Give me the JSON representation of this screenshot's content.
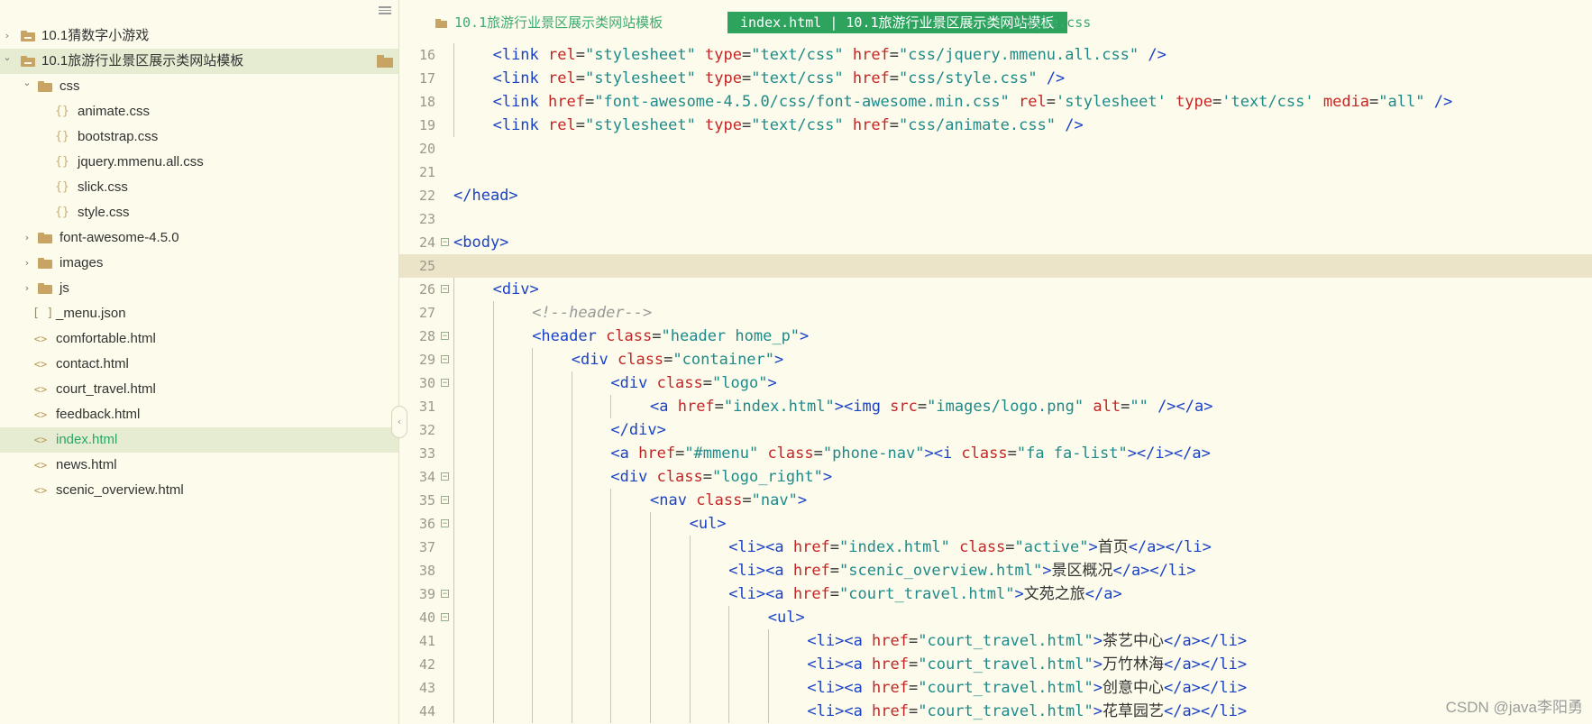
{
  "sidebar": {
    "items": [
      {
        "level": 0,
        "kind": "project",
        "expanded": false,
        "label": "10.1猜数字小游戏"
      },
      {
        "level": 0,
        "kind": "project",
        "expanded": true,
        "label": "10.1旅游行业景区展示类网站模板",
        "selected": true
      },
      {
        "level": 1,
        "kind": "folder",
        "expanded": true,
        "label": "css"
      },
      {
        "level": 2,
        "kind": "css",
        "label": "animate.css"
      },
      {
        "level": 2,
        "kind": "css",
        "label": "bootstrap.css"
      },
      {
        "level": 2,
        "kind": "css",
        "label": "jquery.mmenu.all.css"
      },
      {
        "level": 2,
        "kind": "css",
        "label": "slick.css"
      },
      {
        "level": 2,
        "kind": "css",
        "label": "style.css"
      },
      {
        "level": 1,
        "kind": "folder",
        "expanded": false,
        "label": "font-awesome-4.5.0"
      },
      {
        "level": 1,
        "kind": "folder",
        "expanded": false,
        "label": "images"
      },
      {
        "level": 1,
        "kind": "folder",
        "expanded": false,
        "label": "js"
      },
      {
        "level": 1,
        "kind": "json",
        "label": "_menu.json"
      },
      {
        "level": 1,
        "kind": "html",
        "label": "comfortable.html"
      },
      {
        "level": 1,
        "kind": "html",
        "label": "contact.html"
      },
      {
        "level": 1,
        "kind": "html",
        "label": "court_travel.html"
      },
      {
        "level": 1,
        "kind": "html",
        "label": "feedback.html"
      },
      {
        "level": 1,
        "kind": "html",
        "label": "index.html",
        "active": true
      },
      {
        "level": 1,
        "kind": "html",
        "label": "news.html"
      },
      {
        "level": 1,
        "kind": "html",
        "label": "scenic_overview.html"
      }
    ]
  },
  "tabs": [
    {
      "label": "10.1旅游行业景区展示类网站模板",
      "kind": "project",
      "active": false
    },
    {
      "label": "index.html | 10.1旅游行业景区展示类网站模板",
      "kind": "file",
      "active": true
    },
    {
      "label": "style.css",
      "kind": "file",
      "active": false
    }
  ],
  "code": {
    "current_line": 25,
    "lines": [
      {
        "n": 16,
        "indent": 1,
        "tokens": [
          [
            "t",
            "<link "
          ],
          [
            "a",
            "rel"
          ],
          [
            "x",
            "="
          ],
          [
            "v",
            "\"stylesheet\" "
          ],
          [
            "a",
            "type"
          ],
          [
            "x",
            "="
          ],
          [
            "v",
            "\"text/css\" "
          ],
          [
            "a",
            "href"
          ],
          [
            "x",
            "="
          ],
          [
            "v",
            "\"css/jquery.mmenu.all.css\" "
          ],
          [
            "t",
            "/>"
          ]
        ]
      },
      {
        "n": 17,
        "indent": 1,
        "tokens": [
          [
            "t",
            "<link "
          ],
          [
            "a",
            "rel"
          ],
          [
            "x",
            "="
          ],
          [
            "v",
            "\"stylesheet\" "
          ],
          [
            "a",
            "type"
          ],
          [
            "x",
            "="
          ],
          [
            "v",
            "\"text/css\" "
          ],
          [
            "a",
            "href"
          ],
          [
            "x",
            "="
          ],
          [
            "v",
            "\"css/style.css\" "
          ],
          [
            "t",
            "/>"
          ]
        ]
      },
      {
        "n": 18,
        "indent": 1,
        "tokens": [
          [
            "t",
            "<link "
          ],
          [
            "a",
            "href"
          ],
          [
            "x",
            "="
          ],
          [
            "v",
            "\"font-awesome-4.5.0/css/font-awesome.min.css\" "
          ],
          [
            "a",
            "rel"
          ],
          [
            "x",
            "="
          ],
          [
            "v",
            "'stylesheet' "
          ],
          [
            "a",
            "type"
          ],
          [
            "x",
            "="
          ],
          [
            "v",
            "'text/css' "
          ],
          [
            "a",
            "media"
          ],
          [
            "x",
            "="
          ],
          [
            "v",
            "\"all\" "
          ],
          [
            "t",
            "/>"
          ]
        ]
      },
      {
        "n": 19,
        "indent": 1,
        "tokens": [
          [
            "t",
            "<link "
          ],
          [
            "a",
            "rel"
          ],
          [
            "x",
            "="
          ],
          [
            "v",
            "\"stylesheet\" "
          ],
          [
            "a",
            "type"
          ],
          [
            "x",
            "="
          ],
          [
            "v",
            "\"text/css\" "
          ],
          [
            "a",
            "href"
          ],
          [
            "x",
            "="
          ],
          [
            "v",
            "\"css/animate.css\" "
          ],
          [
            "t",
            "/>"
          ]
        ]
      },
      {
        "n": 20,
        "indent": 0,
        "tokens": []
      },
      {
        "n": 21,
        "indent": 0,
        "tokens": []
      },
      {
        "n": 22,
        "indent": 0,
        "tokens": [
          [
            "t",
            "</head>"
          ]
        ]
      },
      {
        "n": 23,
        "indent": 0,
        "tokens": []
      },
      {
        "n": 24,
        "indent": 0,
        "fold": true,
        "tokens": [
          [
            "t",
            "<body>"
          ]
        ]
      },
      {
        "n": 25,
        "indent": 0,
        "tokens": []
      },
      {
        "n": 26,
        "indent": 1,
        "fold": true,
        "tokens": [
          [
            "t",
            "<div>"
          ]
        ]
      },
      {
        "n": 27,
        "indent": 2,
        "tokens": [
          [
            "c",
            "<!--header-->"
          ]
        ]
      },
      {
        "n": 28,
        "indent": 2,
        "fold": true,
        "tokens": [
          [
            "t",
            "<header "
          ],
          [
            "a",
            "class"
          ],
          [
            "x",
            "="
          ],
          [
            "v",
            "\"header home_p\""
          ],
          [
            "t",
            ">"
          ]
        ]
      },
      {
        "n": 29,
        "indent": 3,
        "fold": true,
        "tokens": [
          [
            "t",
            "<div "
          ],
          [
            "a",
            "class"
          ],
          [
            "x",
            "="
          ],
          [
            "v",
            "\"container\""
          ],
          [
            "t",
            ">"
          ]
        ]
      },
      {
        "n": 30,
        "indent": 4,
        "fold": true,
        "tokens": [
          [
            "t",
            "<div "
          ],
          [
            "a",
            "class"
          ],
          [
            "x",
            "="
          ],
          [
            "v",
            "\"logo\""
          ],
          [
            "t",
            ">"
          ]
        ]
      },
      {
        "n": 31,
        "indent": 5,
        "tokens": [
          [
            "t",
            "<a "
          ],
          [
            "a",
            "href"
          ],
          [
            "x",
            "="
          ],
          [
            "v",
            "\"index.html\""
          ],
          [
            "t",
            "><img "
          ],
          [
            "a",
            "src"
          ],
          [
            "x",
            "="
          ],
          [
            "v",
            "\"images/logo.png\" "
          ],
          [
            "a",
            "alt"
          ],
          [
            "x",
            "="
          ],
          [
            "v",
            "\"\" "
          ],
          [
            "t",
            "/></a>"
          ]
        ]
      },
      {
        "n": 32,
        "indent": 4,
        "tokens": [
          [
            "t",
            "</div>"
          ]
        ]
      },
      {
        "n": 33,
        "indent": 4,
        "tokens": [
          [
            "t",
            "<a "
          ],
          [
            "a",
            "href"
          ],
          [
            "x",
            "="
          ],
          [
            "v",
            "\"#mmenu\" "
          ],
          [
            "a",
            "class"
          ],
          [
            "x",
            "="
          ],
          [
            "v",
            "\"phone-nav\""
          ],
          [
            "t",
            "><i "
          ],
          [
            "a",
            "class"
          ],
          [
            "x",
            "="
          ],
          [
            "v",
            "\"fa fa-list\""
          ],
          [
            "t",
            "></i></a>"
          ]
        ]
      },
      {
        "n": 34,
        "indent": 4,
        "fold": true,
        "tokens": [
          [
            "t",
            "<div "
          ],
          [
            "a",
            "class"
          ],
          [
            "x",
            "="
          ],
          [
            "v",
            "\"logo_right\""
          ],
          [
            "t",
            ">"
          ]
        ]
      },
      {
        "n": 35,
        "indent": 5,
        "fold": true,
        "tokens": [
          [
            "t",
            "<nav "
          ],
          [
            "a",
            "class"
          ],
          [
            "x",
            "="
          ],
          [
            "v",
            "\"nav\""
          ],
          [
            "t",
            ">"
          ]
        ]
      },
      {
        "n": 36,
        "indent": 6,
        "fold": true,
        "tokens": [
          [
            "t",
            "<ul>"
          ]
        ]
      },
      {
        "n": 37,
        "indent": 7,
        "tokens": [
          [
            "t",
            "<li><a "
          ],
          [
            "a",
            "href"
          ],
          [
            "x",
            "="
          ],
          [
            "v",
            "\"index.html\" "
          ],
          [
            "a",
            "class"
          ],
          [
            "x",
            "="
          ],
          [
            "v",
            "\"active\""
          ],
          [
            "t",
            ">"
          ],
          [
            "x",
            "首页"
          ],
          [
            "t",
            "</a></li>"
          ]
        ]
      },
      {
        "n": 38,
        "indent": 7,
        "tokens": [
          [
            "t",
            "<li><a "
          ],
          [
            "a",
            "href"
          ],
          [
            "x",
            "="
          ],
          [
            "v",
            "\"scenic_overview.html\""
          ],
          [
            "t",
            ">"
          ],
          [
            "x",
            "景区概况"
          ],
          [
            "t",
            "</a></li>"
          ]
        ]
      },
      {
        "n": 39,
        "indent": 7,
        "fold": true,
        "tokens": [
          [
            "t",
            "<li><a "
          ],
          [
            "a",
            "href"
          ],
          [
            "x",
            "="
          ],
          [
            "v",
            "\"court_travel.html\""
          ],
          [
            "t",
            ">"
          ],
          [
            "x",
            "文苑之旅"
          ],
          [
            "t",
            "</a>"
          ]
        ]
      },
      {
        "n": 40,
        "indent": 8,
        "fold": true,
        "tokens": [
          [
            "t",
            "<ul>"
          ]
        ]
      },
      {
        "n": 41,
        "indent": 9,
        "tokens": [
          [
            "t",
            "<li><a "
          ],
          [
            "a",
            "href"
          ],
          [
            "x",
            "="
          ],
          [
            "v",
            "\"court_travel.html\""
          ],
          [
            "t",
            ">"
          ],
          [
            "x",
            "茶艺中心"
          ],
          [
            "t",
            "</a></li>"
          ]
        ]
      },
      {
        "n": 42,
        "indent": 9,
        "tokens": [
          [
            "t",
            "<li><a "
          ],
          [
            "a",
            "href"
          ],
          [
            "x",
            "="
          ],
          [
            "v",
            "\"court_travel.html\""
          ],
          [
            "t",
            ">"
          ],
          [
            "x",
            "万竹林海"
          ],
          [
            "t",
            "</a></li>"
          ]
        ]
      },
      {
        "n": 43,
        "indent": 9,
        "tokens": [
          [
            "t",
            "<li><a "
          ],
          [
            "a",
            "href"
          ],
          [
            "x",
            "="
          ],
          [
            "v",
            "\"court_travel.html\""
          ],
          [
            "t",
            ">"
          ],
          [
            "x",
            "创意中心"
          ],
          [
            "t",
            "</a></li>"
          ]
        ]
      },
      {
        "n": 44,
        "indent": 9,
        "tokens": [
          [
            "t",
            "<li><a "
          ],
          [
            "a",
            "href"
          ],
          [
            "x",
            "="
          ],
          [
            "v",
            "\"court_travel.html\""
          ],
          [
            "t",
            ">"
          ],
          [
            "x",
            "花草园艺"
          ],
          [
            "t",
            "</a></li>"
          ]
        ]
      }
    ]
  },
  "watermark": "CSDN @java李阳勇",
  "colors": {
    "background": "#fdfbeb",
    "tag": "#1a42c7",
    "attribute": "#c12727",
    "value": "#1e8a8a",
    "comment": "#9a9a9a",
    "active_tab": "#2ea35e",
    "accent_text": "#29a862"
  }
}
